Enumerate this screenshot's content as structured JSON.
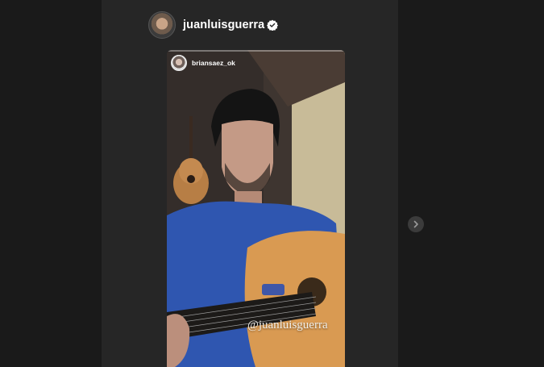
{
  "post": {
    "username": "juanluisguerra",
    "verified": true
  },
  "story": {
    "username": "briansaez_ok",
    "mention": "@juanluisguerra"
  },
  "icons": {
    "verified": "verified-badge-icon",
    "next": "chevron-right-icon"
  },
  "colors": {
    "background": "#1a1a1a",
    "panel": "#262626",
    "shirt": "#2f56b0",
    "guitar": "#d99a52"
  }
}
